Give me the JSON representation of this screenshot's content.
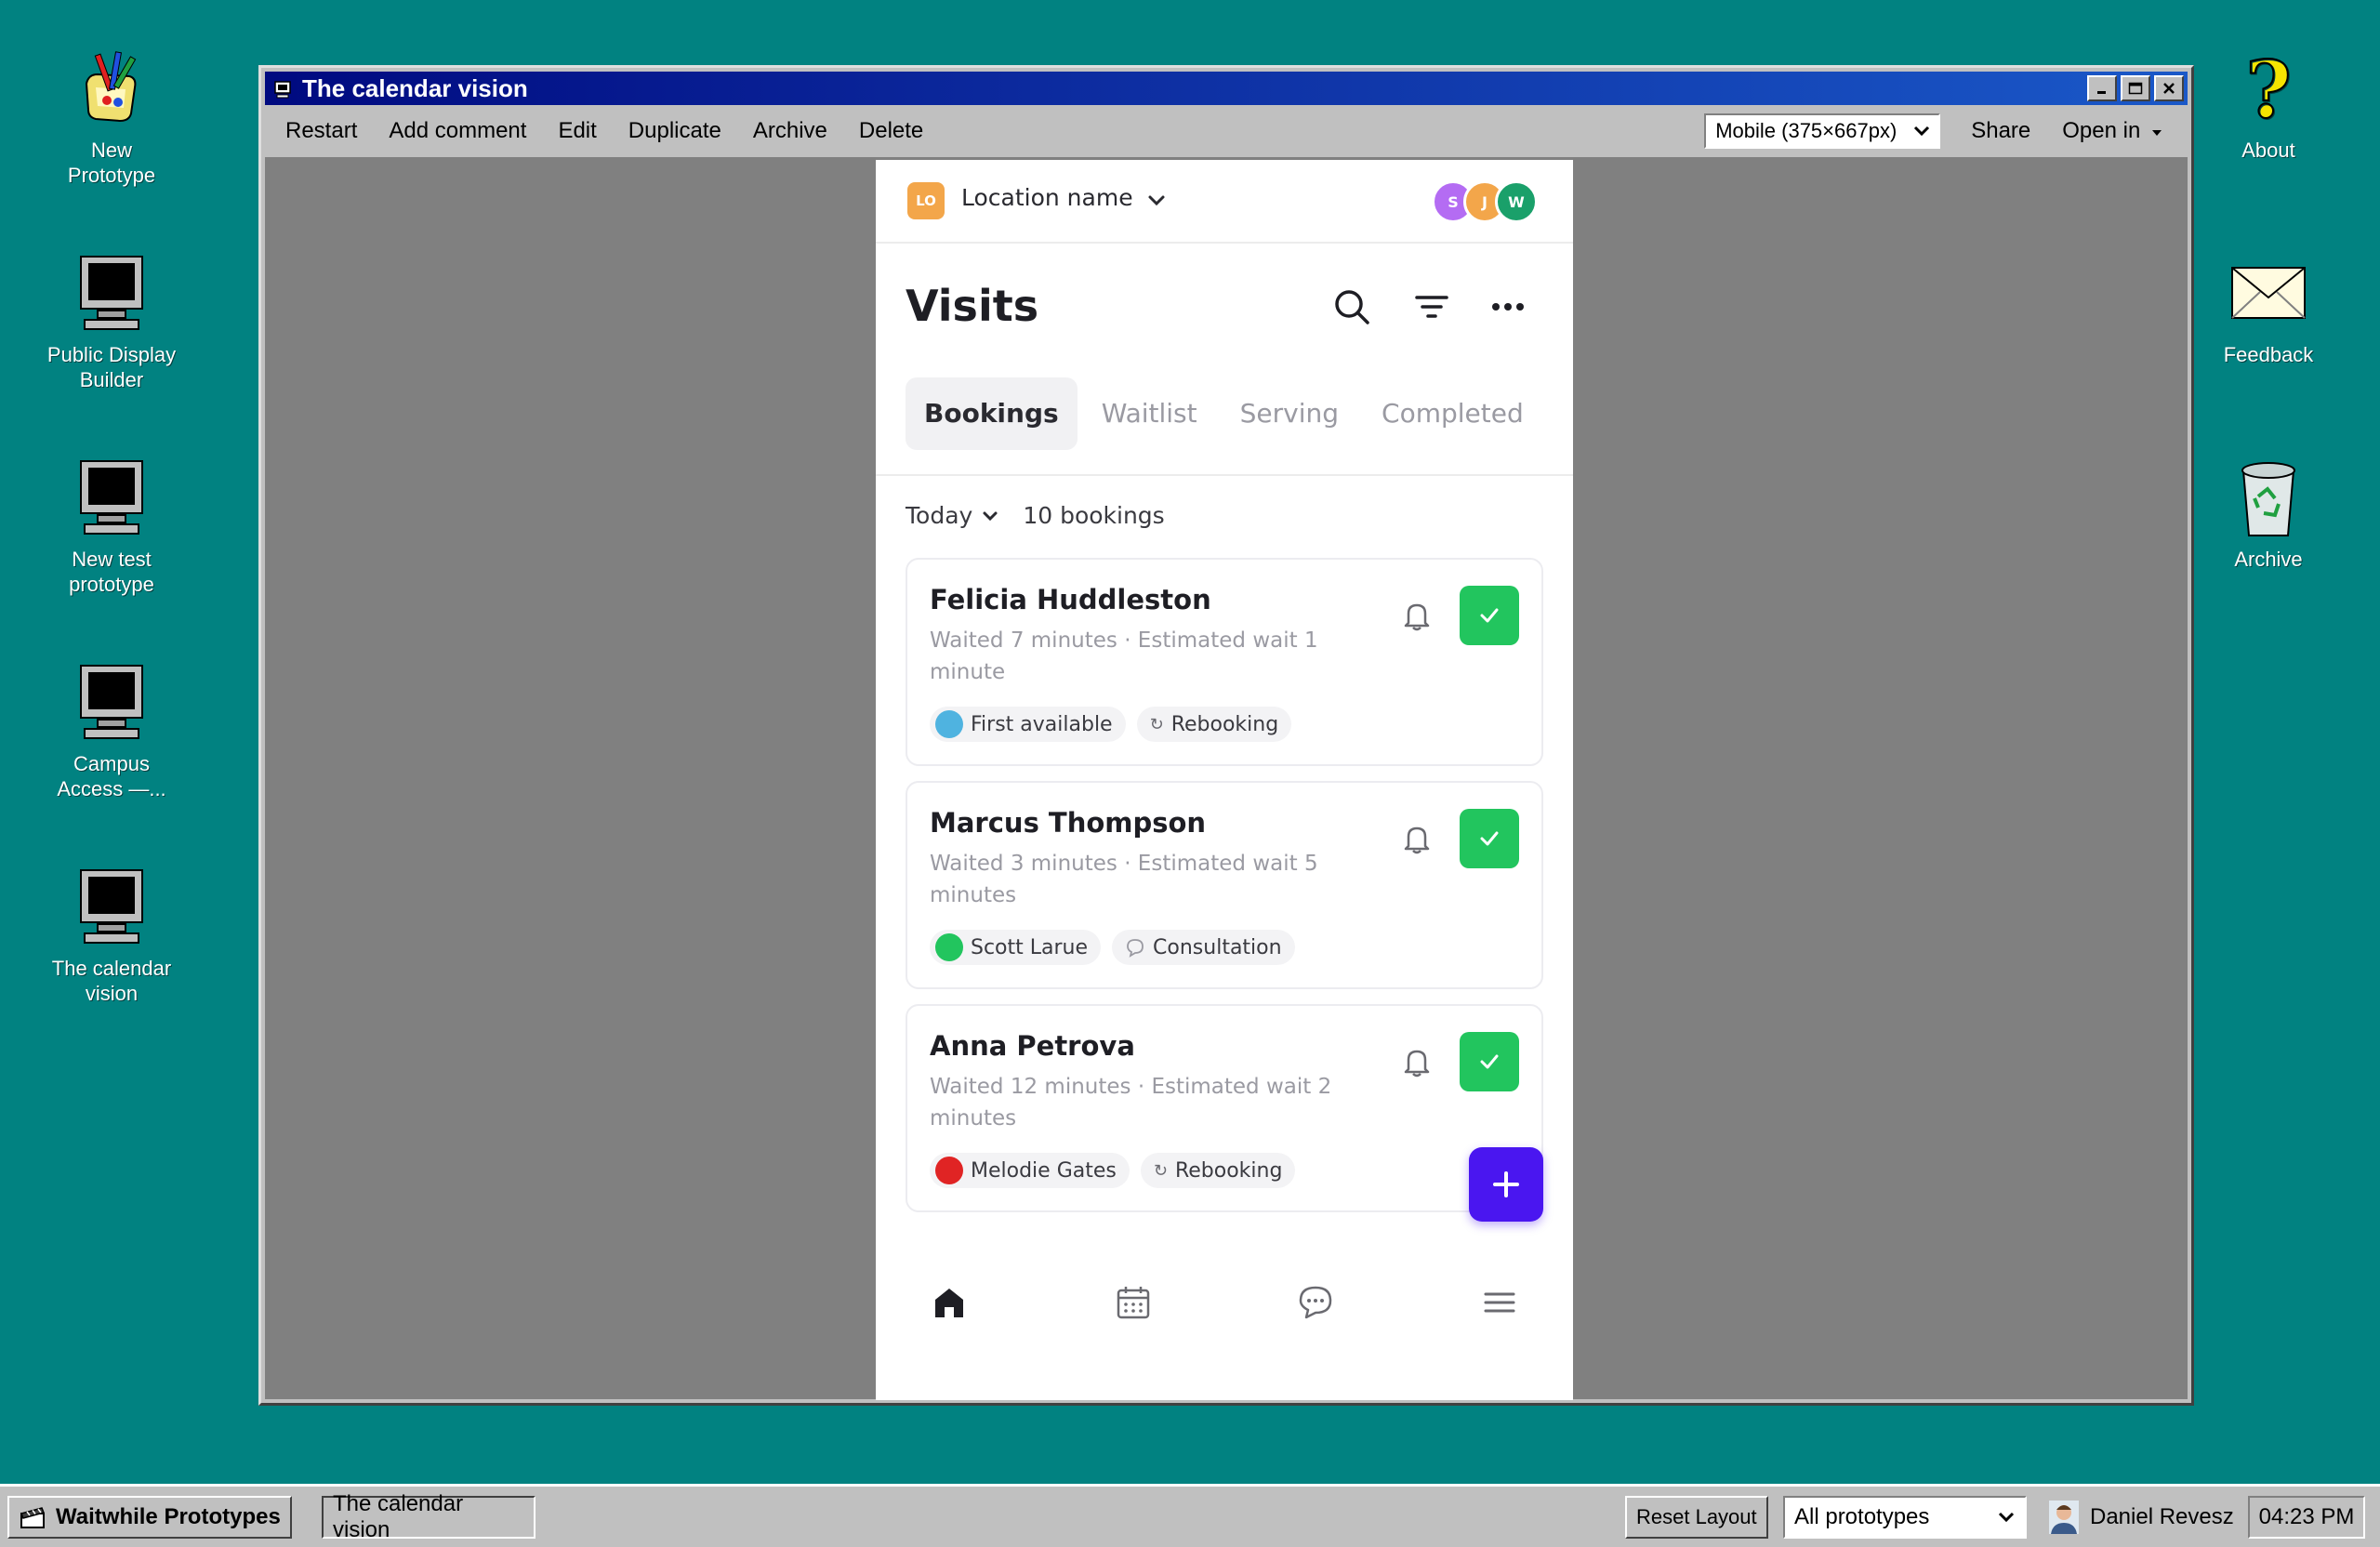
{
  "desktop": {
    "left_icons": [
      {
        "label": "New\nPrototype",
        "icon": "paint-program-icon"
      },
      {
        "label": "Public Display\nBuilder",
        "icon": "monitor-icon"
      },
      {
        "label": "New test\nprototype",
        "icon": "monitor-icon"
      },
      {
        "label": "Campus\nAccess —...",
        "icon": "monitor-icon"
      },
      {
        "label": "The calendar\nvision",
        "icon": "monitor-icon"
      }
    ],
    "right_icons": [
      {
        "label": "About",
        "icon": "help-question-icon"
      },
      {
        "label": "Feedback",
        "icon": "envelope-icon"
      },
      {
        "label": "Archive",
        "icon": "recycle-bin-icon"
      }
    ]
  },
  "window": {
    "title": "The calendar vision",
    "menu": [
      "Restart",
      "Add comment",
      "Edit",
      "Duplicate",
      "Archive",
      "Delete"
    ],
    "device_select": "Mobile (375×667px)",
    "share_label": "Share",
    "open_in_label": "Open in"
  },
  "app": {
    "location_badge": "LO",
    "location_name": "Location name",
    "avatars": [
      {
        "initial": "S",
        "color": "#b46cf3"
      },
      {
        "initial": "J",
        "color": "#f3a64a"
      },
      {
        "initial": "W",
        "color": "#1aa06a"
      }
    ],
    "page_title": "Visits",
    "tabs": [
      "Bookings",
      "Waitlist",
      "Serving",
      "Completed"
    ],
    "active_tab": "Bookings",
    "filter_label": "Today",
    "bookings_count": "10 bookings",
    "cards": [
      {
        "name": "Felicia Huddleston",
        "meta": "Waited 7 minutes · Estimated wait 1 minute",
        "staff_chip": "First available",
        "staff_color": "#4fb3e0",
        "tag_chip": "Rebooking",
        "tag_icon": "↻"
      },
      {
        "name": "Marcus Thompson",
        "meta": "Waited 3 minutes · Estimated wait 5 minutes",
        "staff_chip": "Scott Larue",
        "staff_color": "#22c55e",
        "tag_chip": "Consultation",
        "tag_icon": "💬"
      },
      {
        "name": "Anna Petrova",
        "meta": "Waited 12 minutes · Estimated wait 2 minutes",
        "staff_chip": "Melodie Gates",
        "staff_color": "#e02424",
        "tag_chip": "Rebooking",
        "tag_icon": "↻"
      }
    ],
    "accent_color": "#4a16f0",
    "success_color": "#22c55e"
  },
  "taskbar": {
    "start_label": "Waitwhile Prototypes",
    "task_label": "The calendar vision",
    "reset_label": "Reset Layout",
    "filter_select": "All prototypes",
    "user_name": "Daniel Revesz",
    "clock": "04:23 PM"
  }
}
